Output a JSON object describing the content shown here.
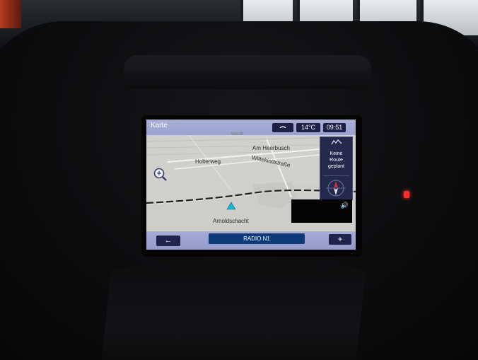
{
  "screen": {
    "title": "Karte",
    "status": {
      "phone_icon": "phone-icon",
      "temperature": "14°C",
      "time": "09:51"
    },
    "map": {
      "labels": {
        "am_heerbusch": "Am Heerbusch",
        "wittekindstrasse": "Wittekindstraße",
        "holterweg": "Holterweg",
        "arnoldschacht": "Arnoldschacht",
        "small_road": "WEG/B"
      },
      "zoom_icon": "magnifier-zoom-icon"
    },
    "route_panel": {
      "icon": "route-icon",
      "line1": "Keine",
      "line2": "Route",
      "line3": "geplant",
      "compass": "compass-icon"
    },
    "audio": {
      "volume_icon": "speaker-icon"
    },
    "bottom": {
      "back_label": "←",
      "radio_label": "RADIO N1",
      "plus_label": "+"
    }
  },
  "colors": {
    "status_bar": "#9aa2cf",
    "button_dark": "#20244d",
    "radio_blue": "#0f3a7a",
    "indicator_red": "#ff2a2a"
  }
}
